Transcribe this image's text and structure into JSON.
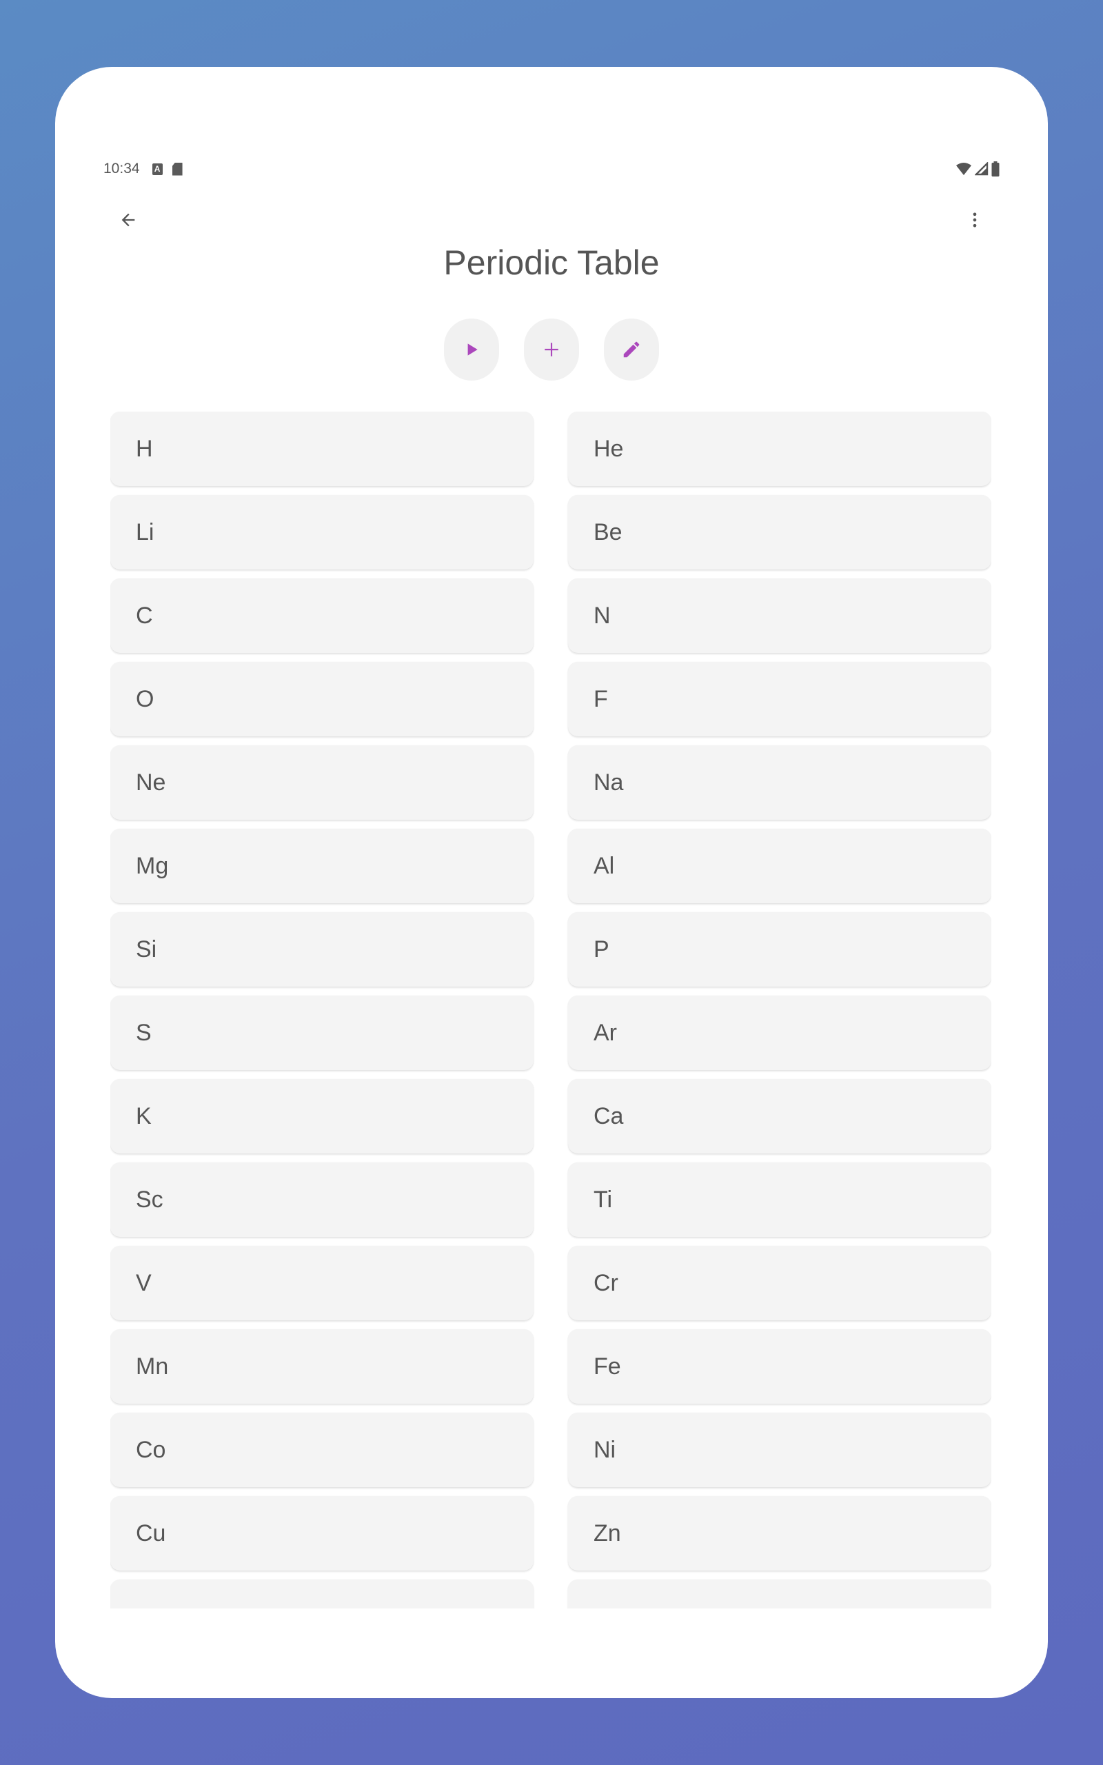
{
  "status_bar": {
    "time": "10:34",
    "icons": [
      "a-notification-icon",
      "sd-card-icon",
      "wifi-icon",
      "cellular-signal-icon",
      "battery-icon"
    ]
  },
  "app_bar": {
    "back_icon": "arrow-back-icon",
    "more_icon": "more-vert-icon"
  },
  "title": "Periodic Table",
  "actions": [
    {
      "name": "play",
      "icon": "play-icon"
    },
    {
      "name": "add",
      "icon": "plus-icon"
    },
    {
      "name": "edit",
      "icon": "pencil-icon"
    }
  ],
  "accent_color": "#ab47bc",
  "elements": [
    "H",
    "He",
    "Li",
    "Be",
    "C",
    "N",
    "O",
    "F",
    "Ne",
    "Na",
    "Mg",
    "Al",
    "Si",
    "P",
    "S",
    "Ar",
    "K",
    "Ca",
    "Sc",
    "Ti",
    "V",
    "Cr",
    "Mn",
    "Fe",
    "Co",
    "Ni",
    "Cu",
    "Zn",
    "",
    ""
  ]
}
